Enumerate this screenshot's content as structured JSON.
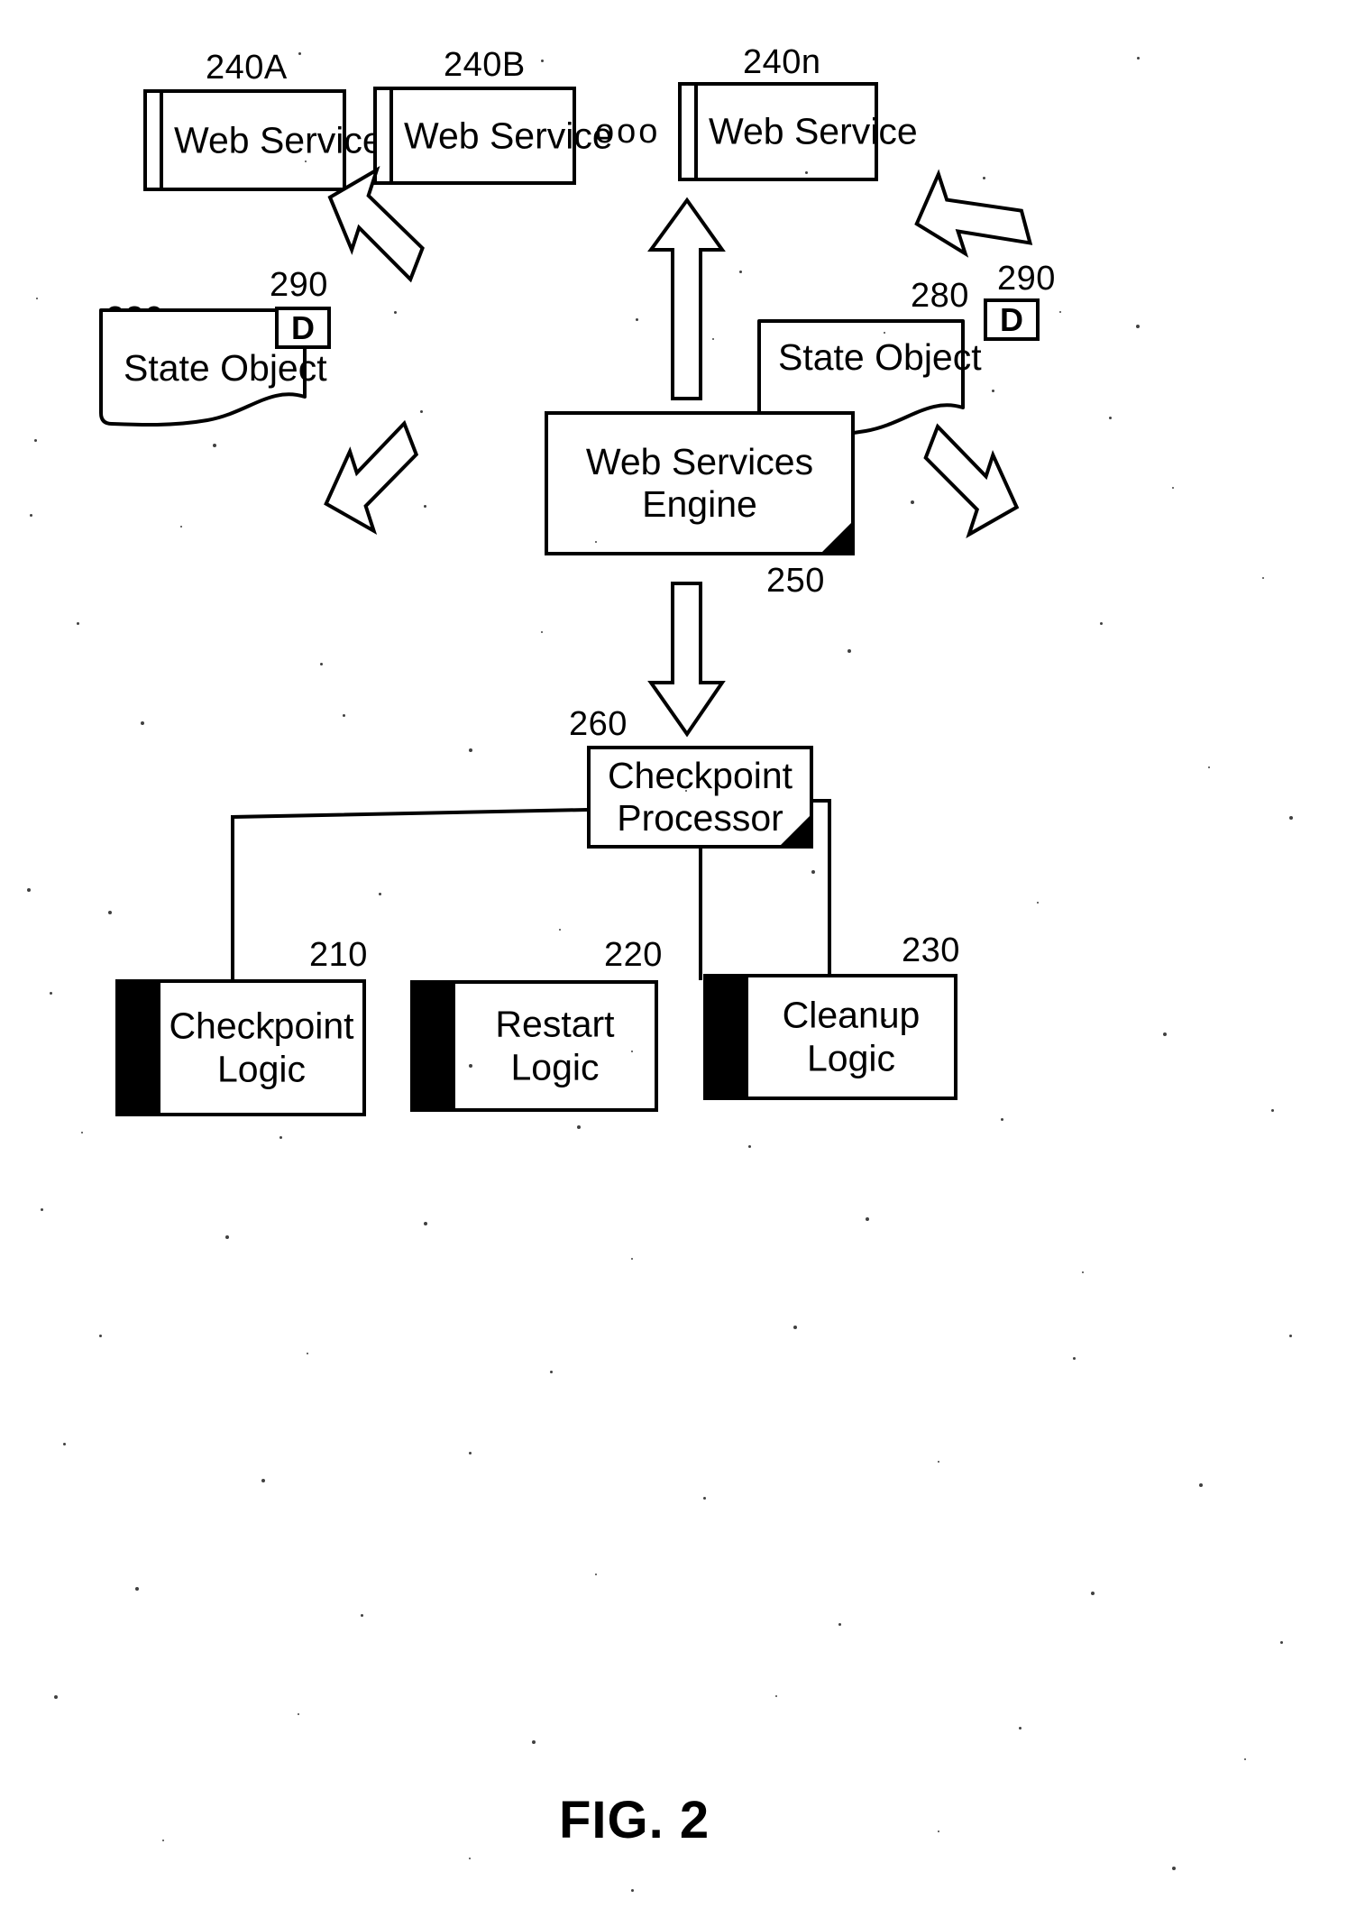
{
  "figure": {
    "caption": "FIG. 2",
    "ellipsis": "ooo"
  },
  "web_services": [
    {
      "ref": "240A",
      "label": "Web Service"
    },
    {
      "ref": "240B",
      "label": "Web Service"
    },
    {
      "ref": "240n",
      "label": "Web Service"
    }
  ],
  "engine": {
    "ref": "250",
    "label_line1": "Web Services",
    "label_line2": "Engine"
  },
  "processor": {
    "ref": "260",
    "label_line1": "Checkpoint",
    "label_line2": "Processor"
  },
  "state_objects": [
    {
      "ref": "280",
      "label": "State Object",
      "badge_ref": "290",
      "badge_label": "D",
      "side": "left"
    },
    {
      "ref": "280",
      "label": "State Object",
      "badge_ref": "290",
      "badge_label": "D",
      "side": "right"
    }
  ],
  "logic_blocks": [
    {
      "ref": "210",
      "label_line1": "Checkpoint",
      "label_line2": "Logic"
    },
    {
      "ref": "220",
      "label_line1": "Restart Logic",
      "label_line2": ""
    },
    {
      "ref": "230",
      "label_line1": "Cleanup Logic",
      "label_line2": ""
    }
  ],
  "colors": {
    "ink": "#000000",
    "paper": "#ffffff"
  }
}
